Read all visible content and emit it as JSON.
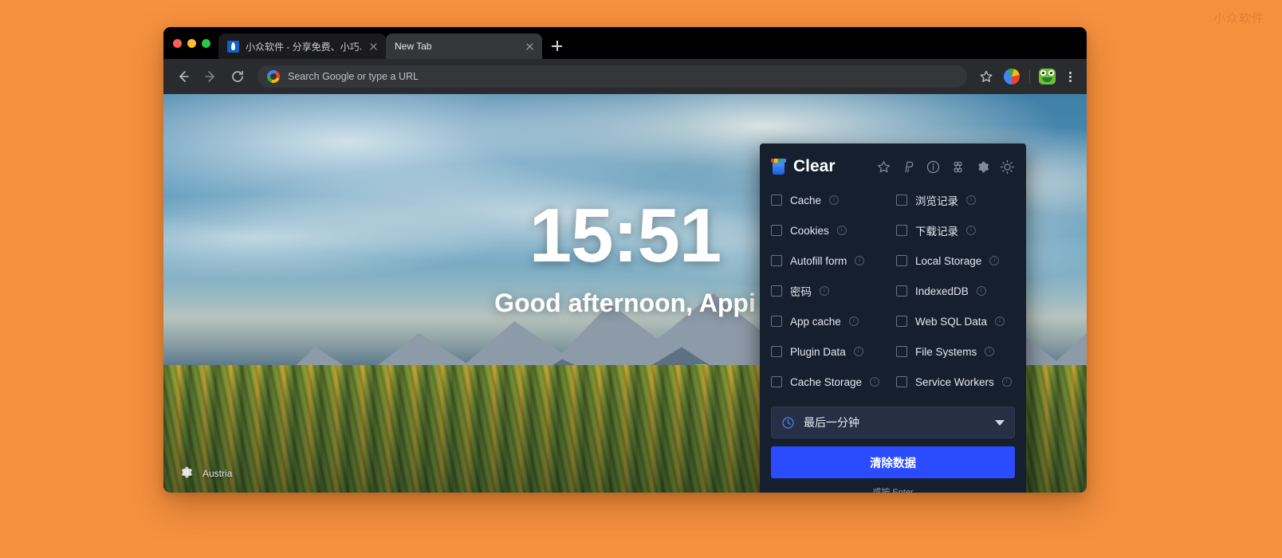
{
  "watermark": "小众软件",
  "browser": {
    "tabs": [
      {
        "title": "小众软件 - 分享免费、小巧、实",
        "active": false,
        "favicon": "drop-favicon"
      },
      {
        "title": "New Tab",
        "active": true,
        "favicon": "none"
      }
    ],
    "new_tab_button": "+",
    "toolbar": {
      "back": "back-arrow",
      "forward": "forward-arrow",
      "reload": "reload-arrow",
      "omnibox_placeholder": "Search Google or type a URL",
      "omnibox_value": "",
      "bookmark": "star-icon",
      "profile": "profile-avatar",
      "extension": "frog-extension-icon",
      "menu": "three-dot-menu"
    }
  },
  "newtab": {
    "clock": "15:51",
    "greeting": "Good afternoon, Appi",
    "location": "Austria",
    "settings_icon": "gear-icon"
  },
  "popup": {
    "title": "Clear",
    "logo": "trash-bin-icon",
    "header_icons": [
      {
        "name": "star-icon",
        "label": "Rate"
      },
      {
        "name": "paypal-icon",
        "label": "Donate"
      },
      {
        "name": "info-icon",
        "label": "About"
      },
      {
        "name": "command-icon",
        "label": "Shortcuts"
      },
      {
        "name": "gear-icon",
        "label": "Settings"
      },
      {
        "name": "sun-icon",
        "label": "Theme"
      }
    ],
    "options_left": [
      {
        "label": "Cache",
        "checked": false
      },
      {
        "label": "Cookies",
        "checked": false
      },
      {
        "label": "Autofill form",
        "checked": false
      },
      {
        "label": "密码",
        "checked": false
      },
      {
        "label": "App cache",
        "checked": false
      },
      {
        "label": "Plugin Data",
        "checked": false
      },
      {
        "label": "Cache Storage",
        "checked": false
      }
    ],
    "options_right": [
      {
        "label": "浏览记录",
        "checked": false
      },
      {
        "label": "下载记录",
        "checked": false
      },
      {
        "label": "Local Storage",
        "checked": false
      },
      {
        "label": "IndexedDB",
        "checked": false
      },
      {
        "label": "Web SQL Data",
        "checked": false
      },
      {
        "label": "File Systems",
        "checked": false
      },
      {
        "label": "Service Workers",
        "checked": false
      }
    ],
    "timerange": {
      "icon": "clock-icon",
      "value": "最后一分钟"
    },
    "clear_button": "清除数据",
    "hint": "或按 Enter",
    "colors": {
      "panel_bg": "#161f2e",
      "select_bg": "#253044",
      "accent": "#2a4bff",
      "text": "#e3e8ef"
    }
  }
}
